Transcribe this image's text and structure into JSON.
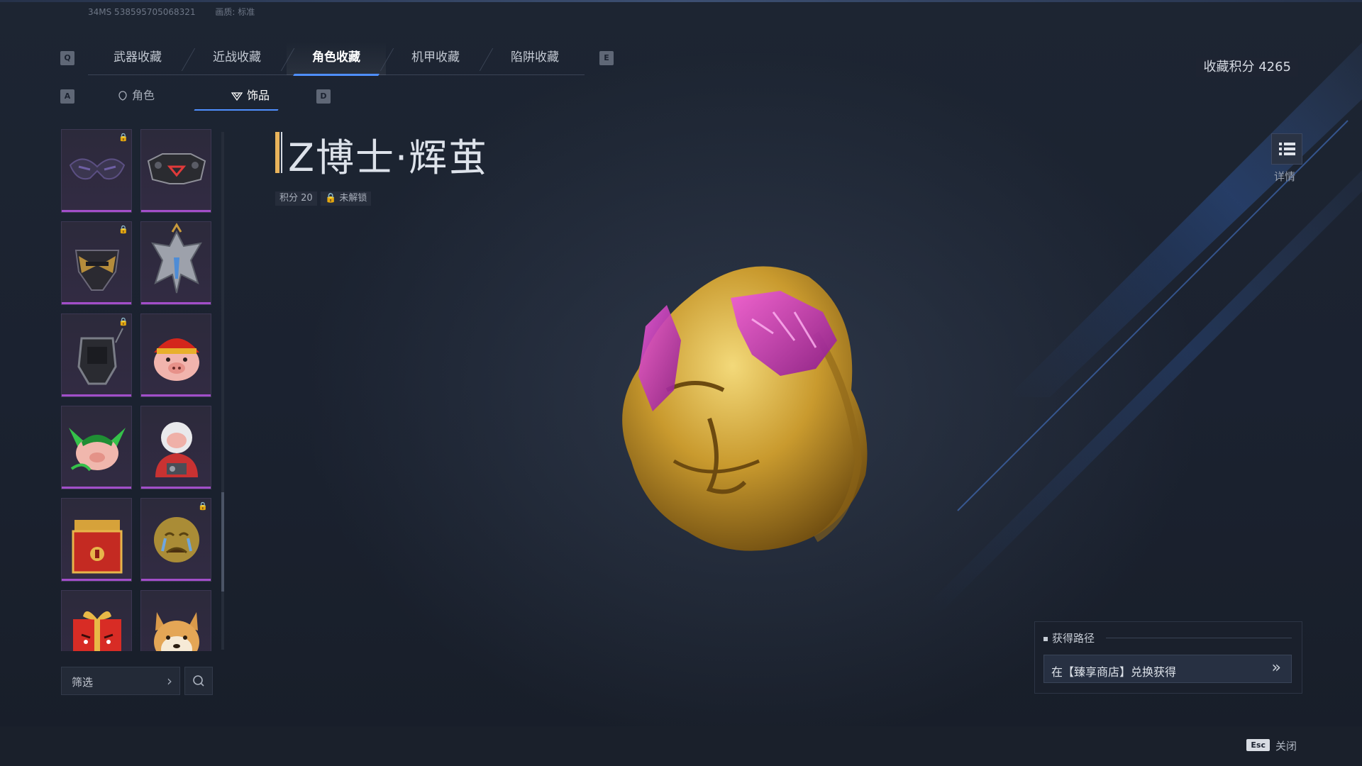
{
  "meta": {
    "session": "34MS 538595705068321",
    "quality": "画质: 标准"
  },
  "keys": {
    "left_tab": "Q",
    "right_tab": "E",
    "left_sub": "A",
    "right_sub": "D"
  },
  "tabs": [
    {
      "label": "武器收藏",
      "active": false
    },
    {
      "label": "近战收藏",
      "active": false
    },
    {
      "label": "角色收藏",
      "active": true
    },
    {
      "label": "机甲收藏",
      "active": false
    },
    {
      "label": "陷阱收藏",
      "active": false
    }
  ],
  "subtabs": [
    {
      "label": "角色",
      "icon": "head-outline-icon",
      "active": false
    },
    {
      "label": "饰品",
      "icon": "accessory-icon",
      "active": true
    }
  ],
  "items": [
    {
      "icon": "dark-mask-icon",
      "locked": true
    },
    {
      "icon": "tech-mask-icon",
      "locked": false
    },
    {
      "icon": "gold-helmet-icon",
      "locked": true
    },
    {
      "icon": "silver-mech-icon",
      "locked": false
    },
    {
      "icon": "gray-helmet-icon",
      "locked": true
    },
    {
      "icon": "pig-red-hat-icon",
      "locked": false
    },
    {
      "icon": "pig-green-horns-icon",
      "locked": false
    },
    {
      "icon": "pig-astronaut-icon",
      "locked": false
    },
    {
      "icon": "red-treasure-chest-icon",
      "locked": false
    },
    {
      "icon": "crying-emoji-icon",
      "locked": true
    },
    {
      "icon": "angry-gift-box-icon",
      "locked": false
    },
    {
      "icon": "shiba-dog-icon",
      "locked": false
    }
  ],
  "filter": {
    "label": "筛选",
    "search_icon": "search-icon"
  },
  "selected": {
    "title": "Z博士·辉茧",
    "points": "积分 20",
    "status": "未解锁"
  },
  "score": {
    "label": "收藏积分 4265"
  },
  "details": {
    "label": "详情",
    "icon": "list-icon"
  },
  "source": {
    "heading": "获得路径",
    "text": "在【臻享商店】兑换获得"
  },
  "footer": {
    "esc_key": "Esc",
    "close_label": "关闭"
  },
  "colors": {
    "accent": "#4f8fff",
    "rarity": "#a24ec9",
    "title_bar": "#e8b35b",
    "background": "#1b2230"
  }
}
